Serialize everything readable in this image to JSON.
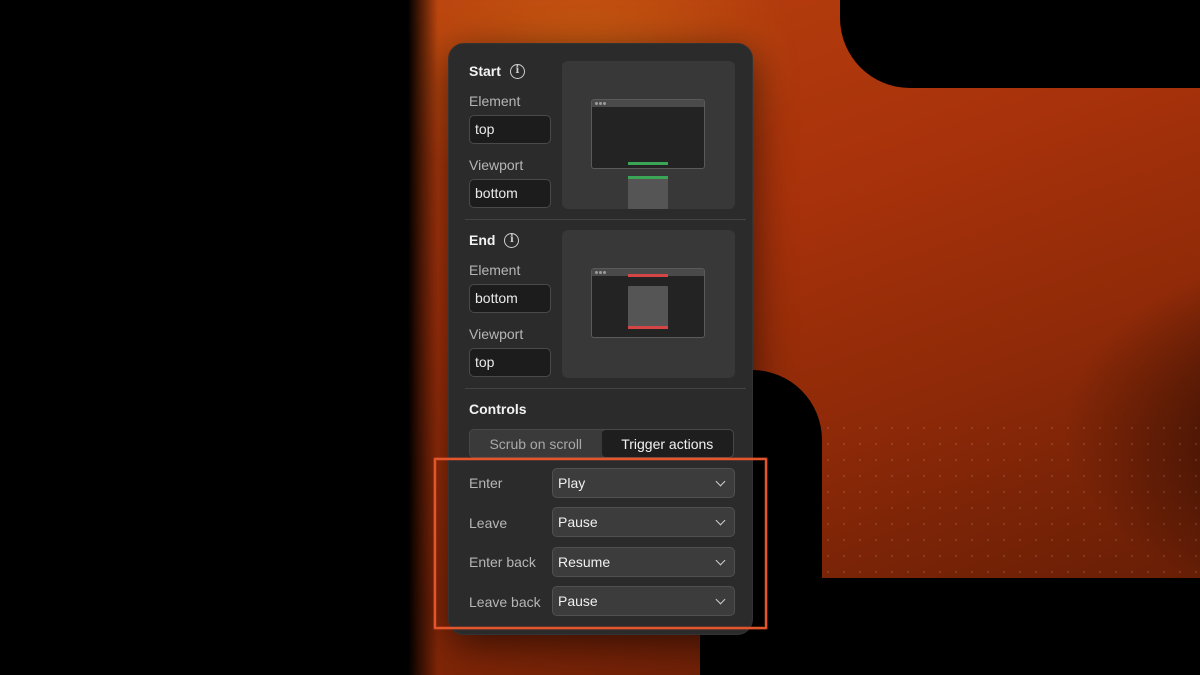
{
  "start": {
    "title": "Start",
    "element_label": "Element",
    "element_value": "top",
    "viewport_label": "Viewport",
    "viewport_value": "bottom"
  },
  "end": {
    "title": "End",
    "element_label": "Element",
    "element_value": "bottom",
    "viewport_label": "Viewport",
    "viewport_value": "top"
  },
  "controls": {
    "title": "Controls",
    "tabs": [
      {
        "label": "Scrub on scroll",
        "active": false
      },
      {
        "label": "Trigger actions",
        "active": true
      }
    ],
    "rows": [
      {
        "label": "Enter",
        "value": "Play"
      },
      {
        "label": "Leave",
        "value": "Pause"
      },
      {
        "label": "Enter back",
        "value": "Resume"
      },
      {
        "label": "Leave back",
        "value": "Pause"
      }
    ]
  },
  "icons": {
    "info": "info-icon",
    "chevron": "chevron-down-icon"
  },
  "colors": {
    "start_marker": "#3aa655",
    "end_marker": "#d64545",
    "highlight": "#e3552a",
    "panel_bg": "#2b2b2b"
  }
}
